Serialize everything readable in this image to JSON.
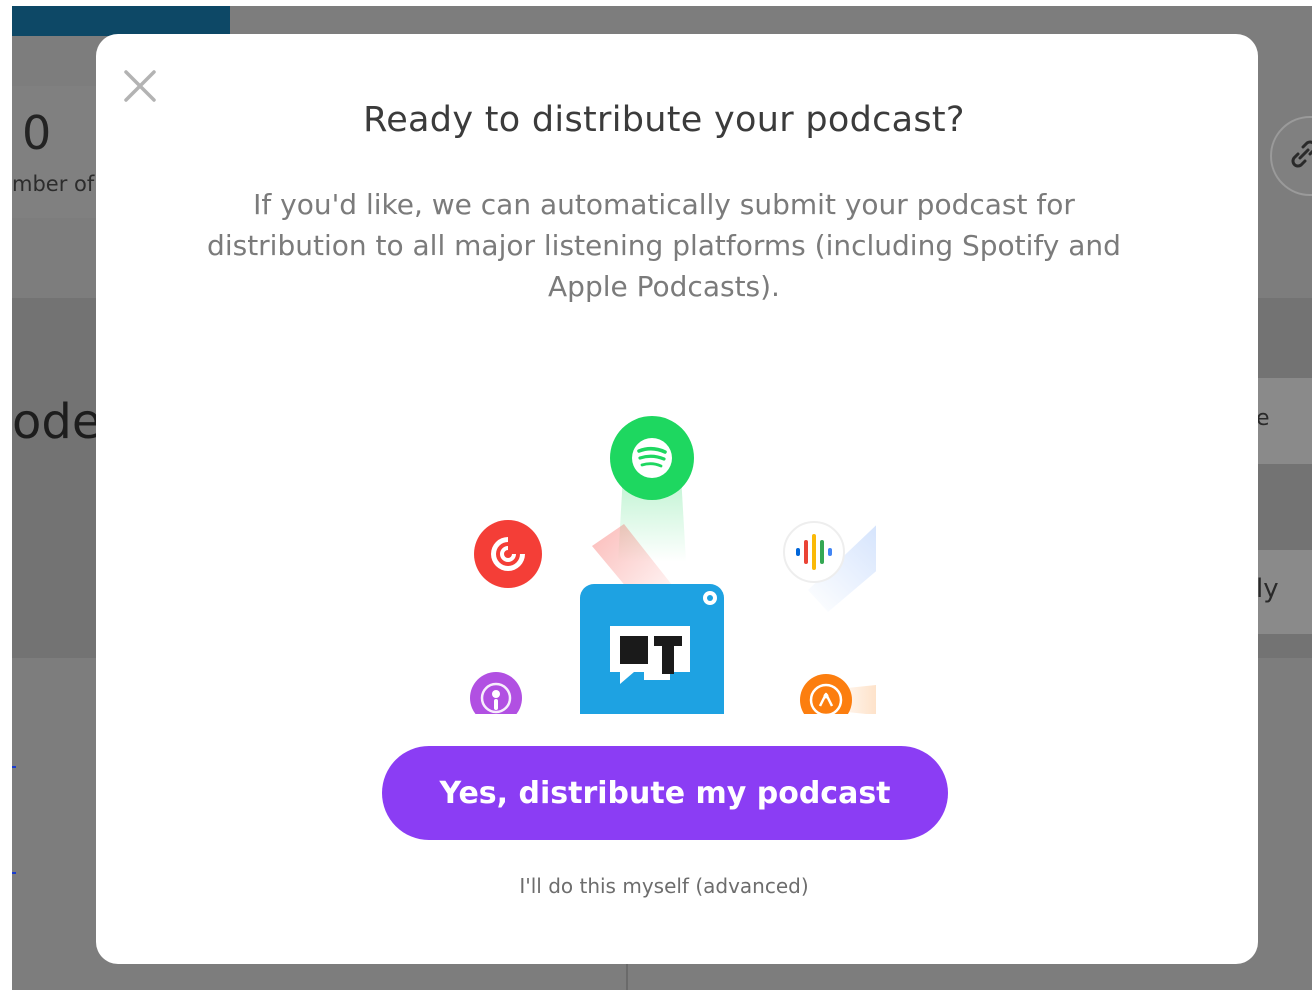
{
  "background": {
    "stat_number": "0",
    "stat_label": "mber of",
    "section_title": "ode",
    "right_row1_text": "e",
    "right_row2_text": "ly",
    "link_icon": "link-icon"
  },
  "modal": {
    "title": "Ready to distribute your podcast?",
    "description": "If you'd like, we can automatically submit your podcast for distribution to all major listening platforms (including Spotify and Apple Podcasts).",
    "primary_button_label": "Yes, distribute my podcast",
    "secondary_link_label": "I'll do this myself (advanced)",
    "close_icon": "close-icon"
  },
  "illustration": {
    "center_logo": "castos-logo-icon",
    "platforms": [
      "spotify-icon",
      "pocket-casts-icon",
      "google-podcasts-icon",
      "apple-podcasts-icon",
      "overcast-icon"
    ]
  },
  "colors": {
    "primary_button": "#8b3df4",
    "center_logo": "#1ea2e2",
    "spotify": "#1ed760",
    "pocket_casts": "#f43e37",
    "apple_podcasts": "#b150e2",
    "overcast": "#fc7e0f",
    "overlay_background": "#7d7d7d"
  }
}
